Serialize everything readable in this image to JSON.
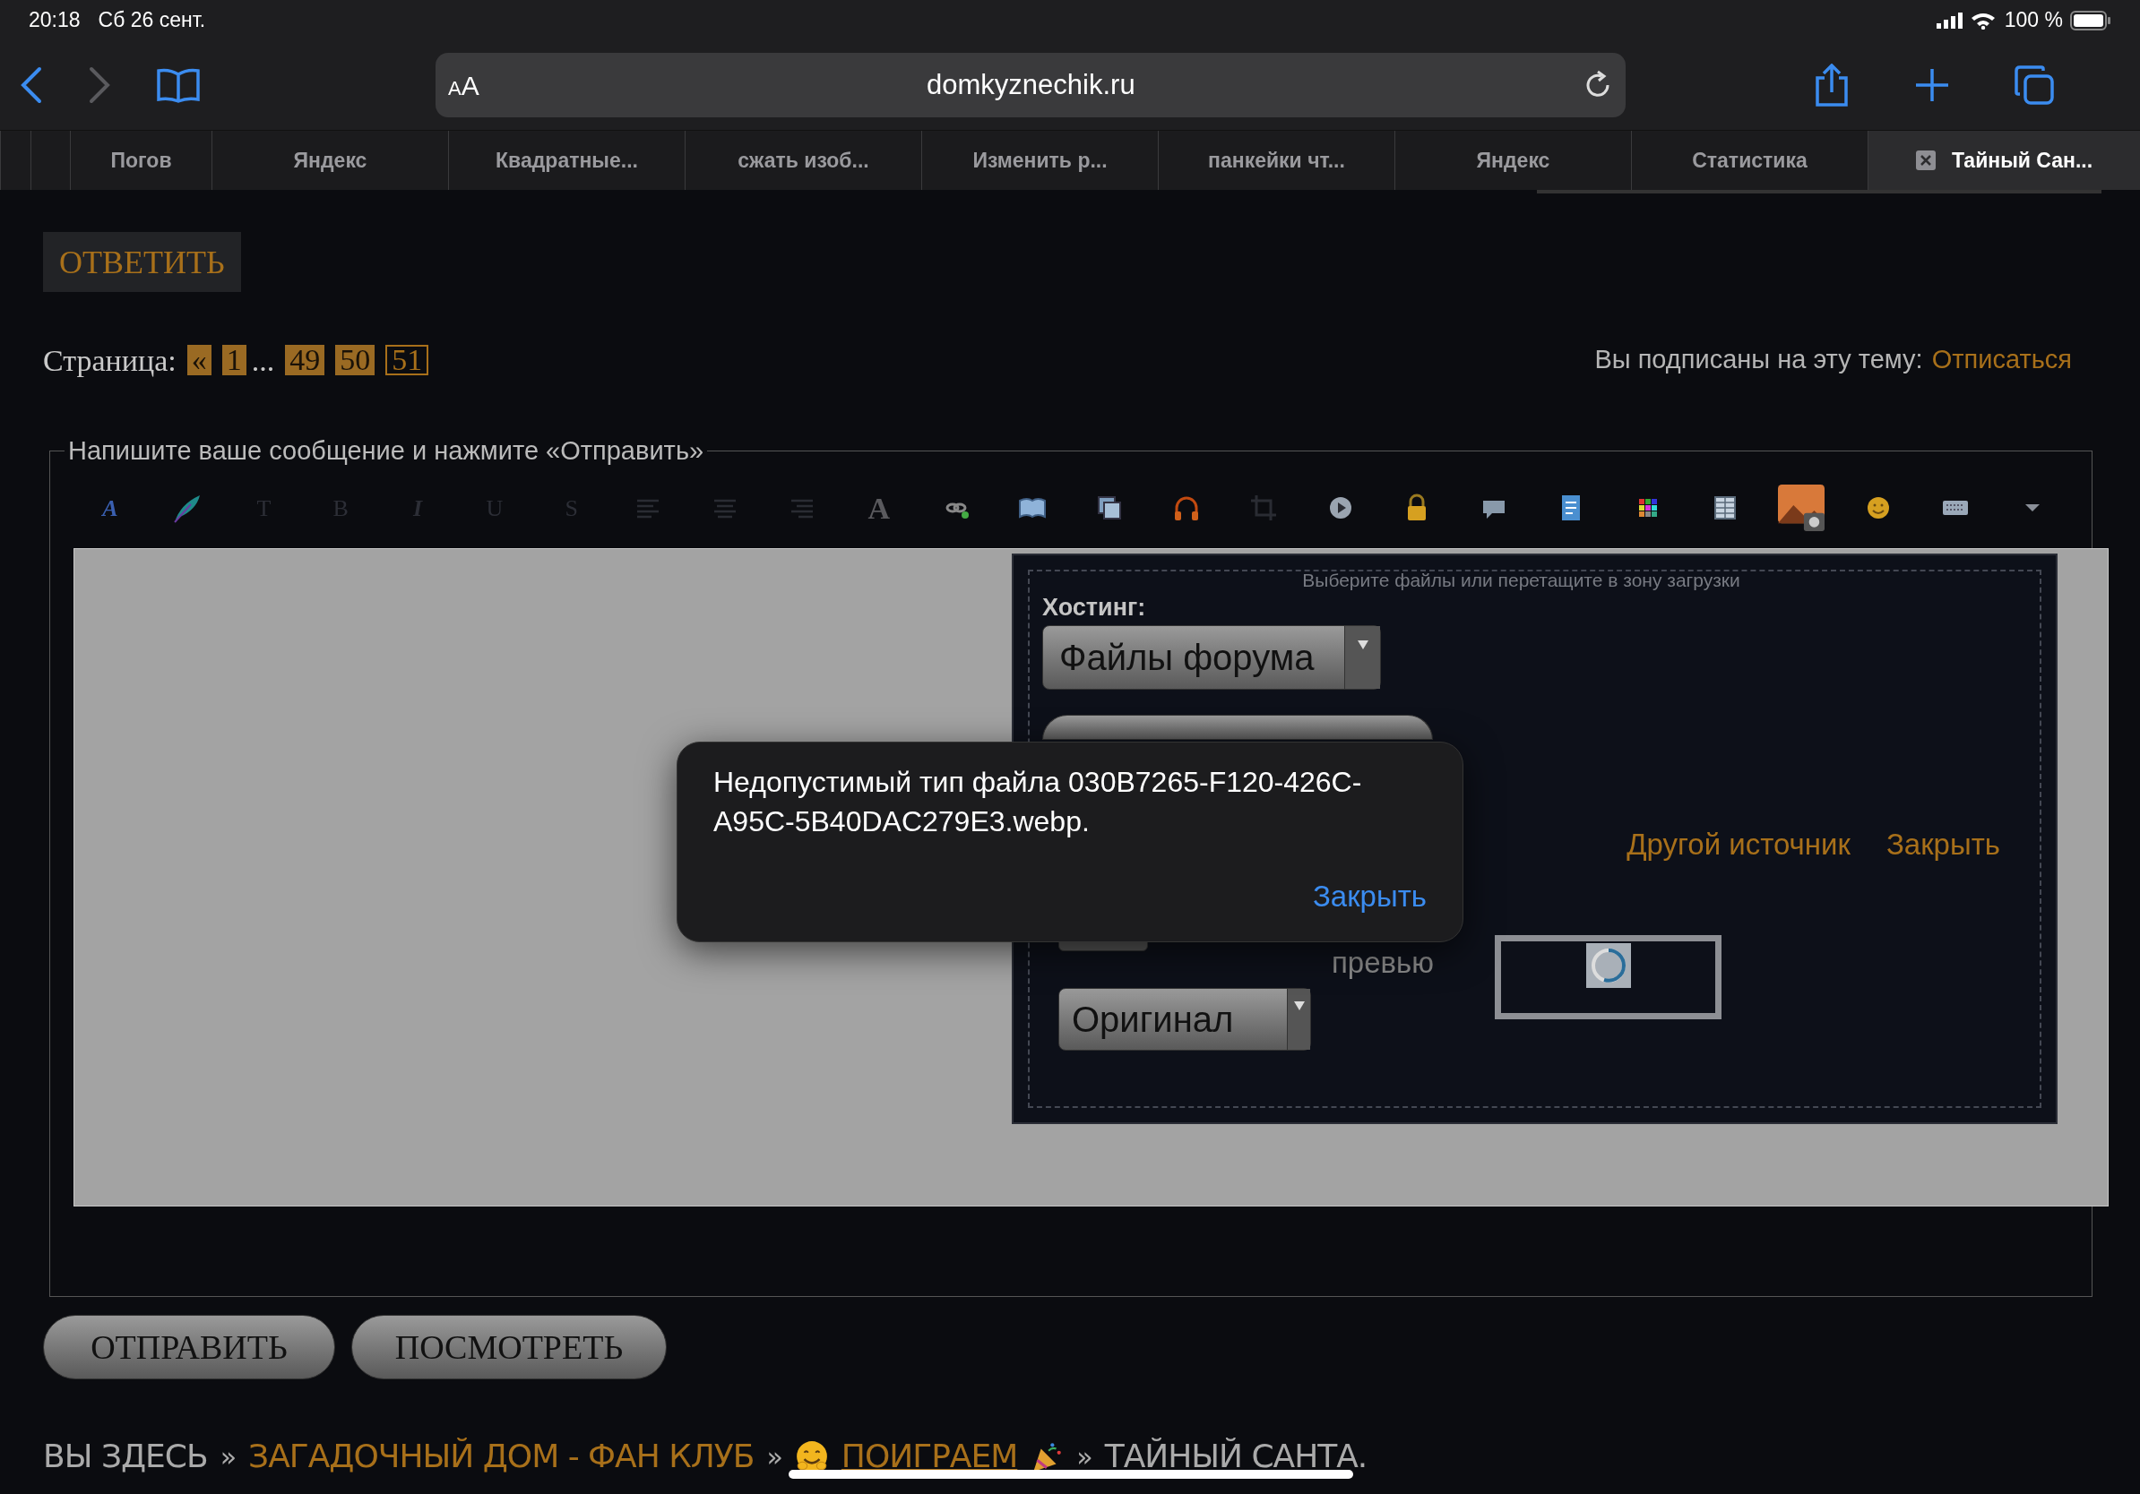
{
  "status_bar": {
    "time": "20:18",
    "date": "Сб 26 сент.",
    "battery": "100 %"
  },
  "browser": {
    "text_size_button": "AA",
    "url": "domkyznechik.ru"
  },
  "tabs": [
    {
      "selected": false
    },
    {
      "selected": false
    },
    {
      "label": "Погов",
      "selected": false
    },
    {
      "label": "Яндекс",
      "selected": false
    },
    {
      "label": "Квадратные...",
      "selected": false
    },
    {
      "label": "сжать изоб...",
      "selected": false
    },
    {
      "label": "Изменить р...",
      "selected": false
    },
    {
      "label": "панкейки чт...",
      "selected": false
    },
    {
      "label": "Яндекс",
      "selected": false
    },
    {
      "label": "Статистика",
      "selected": false
    },
    {
      "label": "Тайный Сан...",
      "selected": true
    }
  ],
  "reply_button": "ОТВЕТИТЬ",
  "pagination": {
    "label": "Страница:",
    "items": [
      {
        "kind": "page",
        "label": "«",
        "selected": false
      },
      {
        "kind": "page",
        "label": "1",
        "selected": false
      },
      {
        "kind": "ellipsis",
        "label": "..."
      },
      {
        "kind": "page",
        "label": "49",
        "selected": false
      },
      {
        "kind": "page",
        "label": "50",
        "selected": false
      },
      {
        "kind": "page",
        "label": "51",
        "selected": true
      }
    ]
  },
  "subscription": {
    "text": "Вы подписаны на эту тему:",
    "link": "Отписаться"
  },
  "composer": {
    "legend": "Напишите ваше сообщение и нажмите «Отправить»",
    "toolbar": [
      {
        "kind": "glyph",
        "label": "A",
        "italic": true,
        "disabled": false
      },
      {
        "kind": "icon"
      },
      {
        "kind": "glyph",
        "label": "T",
        "italic": false,
        "disabled": true
      },
      {
        "kind": "glyph",
        "label": "B",
        "italic": false,
        "disabled": true
      },
      {
        "kind": "glyph",
        "label": "I",
        "italic": true,
        "disabled": true
      },
      {
        "kind": "glyph",
        "label": "U",
        "italic": false,
        "disabled": true
      },
      {
        "kind": "glyph",
        "label": "S",
        "italic": false,
        "disabled": true
      },
      {
        "kind": "icon"
      },
      {
        "kind": "icon"
      },
      {
        "kind": "icon"
      },
      {
        "kind": "glyph",
        "label": "A",
        "italic": false,
        "disabled": false
      },
      {
        "kind": "icon"
      },
      {
        "kind": "icon"
      },
      {
        "kind": "icon"
      },
      {
        "kind": "icon"
      },
      {
        "kind": "icon"
      },
      {
        "kind": "icon"
      },
      {
        "kind": "icon"
      },
      {
        "kind": "icon"
      },
      {
        "kind": "icon"
      },
      {
        "kind": "icon"
      },
      {
        "kind": "icon"
      },
      {
        "kind": "icon"
      },
      {
        "kind": "icon"
      },
      {
        "kind": "icon"
      },
      {
        "kind": "icon"
      }
    ],
    "upload": {
      "hint": "Выберите файлы или перетащите в зону загрузки",
      "hosting_label": "Хостинг:",
      "hosting_select": "Файлы форума",
      "links": [
        "Другой источник",
        "Закрыть"
      ],
      "preview_label": "превью",
      "size_select": "Оригинал"
    }
  },
  "dialog": {
    "message": "Недопустимый тип файла 030B7265-F120-426C-A95C-5B40DAC279E3.webp.",
    "button": "Закрыть"
  },
  "buttons": [
    "ОТПРАВИТЬ",
    "ПОСМОТРЕТЬ"
  ],
  "breadcrumb": [
    {
      "kind": "text",
      "label": "ВЫ ЗДЕСЬ"
    },
    {
      "kind": "sep",
      "label": "»"
    },
    {
      "kind": "link",
      "label": "ЗАГАДОЧНЫЙ ДОМ - ФАН КЛУБ",
      "underlined": false
    },
    {
      "kind": "sep",
      "label": "»"
    },
    {
      "kind": "emoji"
    },
    {
      "kind": "link",
      "label": "ПОИГРАЕМ",
      "underlined": true
    },
    {
      "kind": "emoji"
    },
    {
      "kind": "sep",
      "label": "»"
    },
    {
      "kind": "text",
      "label": "ТАЙНЫЙ САНТА."
    }
  ]
}
